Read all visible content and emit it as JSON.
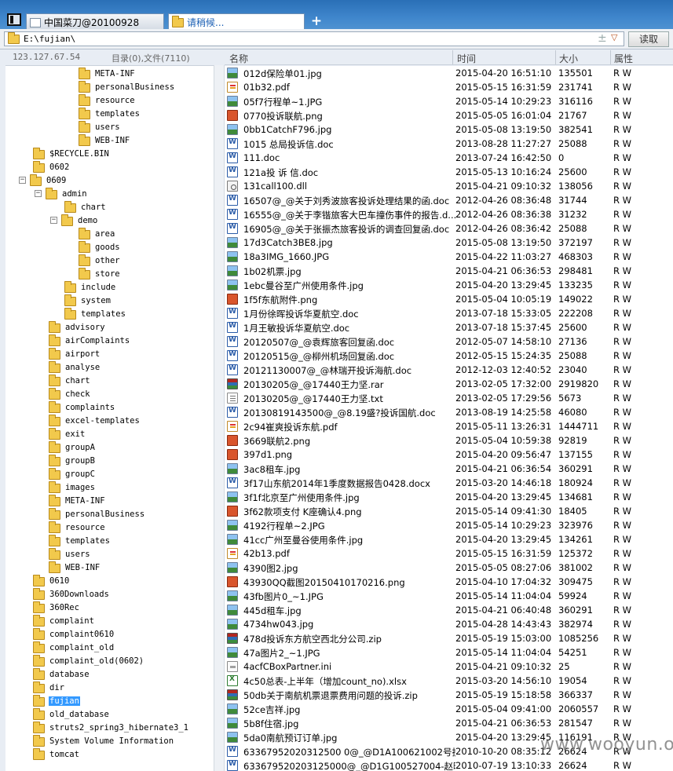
{
  "tabs": [
    {
      "label": "中国菜刀@20100928",
      "active": false
    },
    {
      "label": "请稍候...",
      "active": true
    }
  ],
  "address": {
    "value": "E:\\fujian\\",
    "read_button": "读取"
  },
  "info": {
    "ip": "123.127.67.54",
    "count": "目录(0),文件(7110)"
  },
  "columns": {
    "name": "名称",
    "time": "时间",
    "size": "大小",
    "attr": "属性"
  },
  "tree": [
    {
      "label": "META-INF",
      "level": 4
    },
    {
      "label": "personalBusiness",
      "level": 4
    },
    {
      "label": "resource",
      "level": 4
    },
    {
      "label": "templates",
      "level": 4
    },
    {
      "label": "users",
      "level": 4
    },
    {
      "label": "WEB-INF",
      "level": 4
    },
    {
      "label": "$RECYCLE.BIN",
      "level": 1
    },
    {
      "label": "0602",
      "level": 1
    },
    {
      "label": "0609",
      "level": 1,
      "expanded": true
    },
    {
      "label": "admin",
      "level": 2,
      "expanded": true
    },
    {
      "label": "chart",
      "level": 3
    },
    {
      "label": "demo",
      "level": 3,
      "expanded": true
    },
    {
      "label": "area",
      "level": 4
    },
    {
      "label": "goods",
      "level": 4
    },
    {
      "label": "other",
      "level": 4
    },
    {
      "label": "store",
      "level": 4
    },
    {
      "label": "include",
      "level": 3
    },
    {
      "label": "system",
      "level": 3
    },
    {
      "label": "templates",
      "level": 3
    },
    {
      "label": "advisory",
      "level": 2
    },
    {
      "label": "airComplaints",
      "level": 2
    },
    {
      "label": "airport",
      "level": 2
    },
    {
      "label": "analyse",
      "level": 2
    },
    {
      "label": "chart",
      "level": 2
    },
    {
      "label": "check",
      "level": 2
    },
    {
      "label": "complaints",
      "level": 2
    },
    {
      "label": "excel-templates",
      "level": 2
    },
    {
      "label": "exit",
      "level": 2
    },
    {
      "label": "groupA",
      "level": 2
    },
    {
      "label": "groupB",
      "level": 2
    },
    {
      "label": "groupC",
      "level": 2
    },
    {
      "label": "images",
      "level": 2
    },
    {
      "label": "META-INF",
      "level": 2
    },
    {
      "label": "personalBusiness",
      "level": 2
    },
    {
      "label": "resource",
      "level": 2
    },
    {
      "label": "templates",
      "level": 2
    },
    {
      "label": "users",
      "level": 2
    },
    {
      "label": "WEB-INF",
      "level": 2
    },
    {
      "label": "0610",
      "level": 1
    },
    {
      "label": "360Downloads",
      "level": 1
    },
    {
      "label": "360Rec",
      "level": 1
    },
    {
      "label": "complaint",
      "level": 1
    },
    {
      "label": "complaint0610",
      "level": 1
    },
    {
      "label": "complaint_old",
      "level": 1
    },
    {
      "label": "complaint_old(0602)",
      "level": 1
    },
    {
      "label": "database",
      "level": 1
    },
    {
      "label": "dir",
      "level": 1
    },
    {
      "label": "fujian",
      "level": 1,
      "selected": true
    },
    {
      "label": "old_database",
      "level": 1
    },
    {
      "label": "struts2_spring3_hibernate3_1",
      "level": 1
    },
    {
      "label": "System Volume Information",
      "level": 1
    },
    {
      "label": "tomcat",
      "level": 1
    }
  ],
  "files": [
    {
      "name": "012d保险单01.jpg",
      "time": "2015-04-20 16:51:10",
      "size": "135501",
      "attr": "R W",
      "icon": "img"
    },
    {
      "name": "01b32.pdf",
      "time": "2015-05-15 16:31:59",
      "size": "231741",
      "attr": "R W",
      "icon": "pdf"
    },
    {
      "name": "05f7行程单~1.JPG",
      "time": "2015-05-14 10:29:23",
      "size": "316116",
      "attr": "R W",
      "icon": "img"
    },
    {
      "name": "0770投诉联航.png",
      "time": "2015-05-05 16:01:04",
      "size": "21767",
      "attr": "R W",
      "icon": "png"
    },
    {
      "name": "0bb1CatchF796.jpg",
      "time": "2015-05-08 13:19:50",
      "size": "382541",
      "attr": "R W",
      "icon": "img"
    },
    {
      "name": "1015 总局投诉信.doc",
      "time": "2013-08-28 11:27:27",
      "size": "25088",
      "attr": "R W",
      "icon": "doc"
    },
    {
      "name": "111.doc",
      "time": "2013-07-24 16:42:50",
      "size": "0",
      "attr": "R W",
      "icon": "doc"
    },
    {
      "name": "121a投 诉 信.doc",
      "time": "2015-05-13 10:16:24",
      "size": "25600",
      "attr": "R W",
      "icon": "doc"
    },
    {
      "name": "131call100.dll",
      "time": "2015-04-21 09:10:32",
      "size": "138056",
      "attr": "R W",
      "icon": "dll"
    },
    {
      "name": "16507@_@关于刘秀波旅客投诉处理结果的函.doc",
      "time": "2012-04-26 08:36:48",
      "size": "31744",
      "attr": "R W",
      "icon": "doc"
    },
    {
      "name": "16555@_@关于李锴旅客大巴车撞伤事件的报告.d...",
      "time": "2012-04-26 08:36:38",
      "size": "31232",
      "attr": "R W",
      "icon": "doc"
    },
    {
      "name": "16905@_@关于张振杰旅客投诉的调查回复函.doc",
      "time": "2012-04-26 08:36:42",
      "size": "25088",
      "attr": "R W",
      "icon": "doc"
    },
    {
      "name": "17d3Catch3BE8.jpg",
      "time": "2015-05-08 13:19:50",
      "size": "372197",
      "attr": "R W",
      "icon": "img"
    },
    {
      "name": "18a3IMG_1660.JPG",
      "time": "2015-04-22 11:03:27",
      "size": "468303",
      "attr": "R W",
      "icon": "img"
    },
    {
      "name": "1b02机票.jpg",
      "time": "2015-04-21 06:36:53",
      "size": "298481",
      "attr": "R W",
      "icon": "img"
    },
    {
      "name": "1ebc曼谷至广州使用条件.jpg",
      "time": "2015-04-20 13:29:45",
      "size": "133235",
      "attr": "R W",
      "icon": "img"
    },
    {
      "name": "1f5f东航附件.png",
      "time": "2015-05-04 10:05:19",
      "size": "149022",
      "attr": "R W",
      "icon": "png"
    },
    {
      "name": "1月份徐晖投诉华夏航空.doc",
      "time": "2013-07-18 15:33:05",
      "size": "222208",
      "attr": "R W",
      "icon": "doc"
    },
    {
      "name": "1月王敏投诉华夏航空.doc",
      "time": "2013-07-18 15:37:45",
      "size": "25600",
      "attr": "R W",
      "icon": "doc"
    },
    {
      "name": "20120507@_@袁辉旅客回复函.doc",
      "time": "2012-05-07 14:58:10",
      "size": "27136",
      "attr": "R W",
      "icon": "doc"
    },
    {
      "name": "20120515@_@柳州机场回复函.doc",
      "time": "2012-05-15 15:24:35",
      "size": "25088",
      "attr": "R W",
      "icon": "doc"
    },
    {
      "name": "20121130007@_@林瑞开投诉海航.doc",
      "time": "2012-12-03 12:40:52",
      "size": "23040",
      "attr": "R W",
      "icon": "doc"
    },
    {
      "name": "20130205@_@17440王力坚.rar",
      "time": "2013-02-05 17:32:00",
      "size": "2919820",
      "attr": "R W",
      "icon": "rar"
    },
    {
      "name": "20130205@_@17440王力坚.txt",
      "time": "2013-02-05 17:29:56",
      "size": "5673",
      "attr": "R W",
      "icon": "txt"
    },
    {
      "name": "20130819143500@_@8.19盛?投诉国航.doc",
      "time": "2013-08-19 14:25:58",
      "size": "46080",
      "attr": "R W",
      "icon": "doc"
    },
    {
      "name": "2c94崔爽投诉东航.pdf",
      "time": "2015-05-11 13:26:31",
      "size": "1444711",
      "attr": "R W",
      "icon": "pdf"
    },
    {
      "name": "3669联航2.png",
      "time": "2015-05-04 10:59:38",
      "size": "92819",
      "attr": "R W",
      "icon": "png"
    },
    {
      "name": "397d1.png",
      "time": "2015-04-20 09:56:47",
      "size": "137155",
      "attr": "R W",
      "icon": "png"
    },
    {
      "name": "3ac8租车.jpg",
      "time": "2015-04-21 06:36:54",
      "size": "360291",
      "attr": "R W",
      "icon": "img"
    },
    {
      "name": "3f17山东航2014年1季度数据报告0428.docx",
      "time": "2015-03-20 14:46:18",
      "size": "180924",
      "attr": "R W",
      "icon": "doc"
    },
    {
      "name": "3f1f北京至广州使用条件.jpg",
      "time": "2015-04-20 13:29:45",
      "size": "134681",
      "attr": "R W",
      "icon": "img"
    },
    {
      "name": "3f62款项支付 K座确认4.png",
      "time": "2015-05-14 09:41:30",
      "size": "18405",
      "attr": "R W",
      "icon": "png"
    },
    {
      "name": "4192行程单~2.JPG",
      "time": "2015-05-14 10:29:23",
      "size": "323976",
      "attr": "R W",
      "icon": "img"
    },
    {
      "name": "41cc广州至曼谷使用条件.jpg",
      "time": "2015-04-20 13:29:45",
      "size": "134261",
      "attr": "R W",
      "icon": "img"
    },
    {
      "name": "42b13.pdf",
      "time": "2015-05-15 16:31:59",
      "size": "125372",
      "attr": "R W",
      "icon": "pdf"
    },
    {
      "name": "4390图2.jpg",
      "time": "2015-05-05 08:27:06",
      "size": "381002",
      "attr": "R W",
      "icon": "img"
    },
    {
      "name": "43930QQ截图20150410170216.png",
      "time": "2015-04-10 17:04:32",
      "size": "309475",
      "attr": "R W",
      "icon": "png"
    },
    {
      "name": "43fb图片0_~1.JPG",
      "time": "2015-05-14 11:04:04",
      "size": "59924",
      "attr": "R W",
      "icon": "img"
    },
    {
      "name": "445d租车.jpg",
      "time": "2015-04-21 06:40:48",
      "size": "360291",
      "attr": "R W",
      "icon": "img"
    },
    {
      "name": "4734hw043.jpg",
      "time": "2015-04-28 14:43:43",
      "size": "382974",
      "attr": "R W",
      "icon": "img"
    },
    {
      "name": "478d投诉东方航空西北分公司.zip",
      "time": "2015-05-19 15:03:00",
      "size": "1085256",
      "attr": "R W",
      "icon": "zip"
    },
    {
      "name": "47a图片2_~1.JPG",
      "time": "2015-05-14 11:04:04",
      "size": "54251",
      "attr": "R W",
      "icon": "img"
    },
    {
      "name": "4acfCBoxPartner.ini",
      "time": "2015-04-21 09:10:32",
      "size": "25",
      "attr": "R W",
      "icon": "ini"
    },
    {
      "name": "4c50总表-上半年（增加count_no).xlsx",
      "time": "2015-03-20 14:56:10",
      "size": "19054",
      "attr": "R W",
      "icon": "xls"
    },
    {
      "name": "50db关于南航机票退票费用问题的投诉.zip",
      "time": "2015-05-19 15:18:58",
      "size": "366337",
      "attr": "R W",
      "icon": "zip"
    },
    {
      "name": "52ce吉祥.jpg",
      "time": "2015-05-04 09:41:00",
      "size": "2060557",
      "attr": "R W",
      "icon": "img"
    },
    {
      "name": "5b8f住宿.jpg",
      "time": "2015-04-21 06:36:53",
      "size": "281547",
      "attr": "R W",
      "icon": "img"
    },
    {
      "name": "5da0南航预订订单.jpg",
      "time": "2015-04-20 13:29:45",
      "size": "116191",
      "attr": "R W",
      "icon": "img"
    },
    {
      "name": "63367952020312500 0@_@D1A100621002号投诉补...",
      "time": "2010-10-20 08:35:12",
      "size": "26624",
      "attr": "R W",
      "icon": "doc"
    },
    {
      "name": "633679520203125000@_@D1G100527004-赵晓刚...",
      "time": "2010-07-19 13:10:33",
      "size": "26624",
      "attr": "R W",
      "icon": "doc"
    }
  ],
  "watermark": "www.wooyun.org"
}
